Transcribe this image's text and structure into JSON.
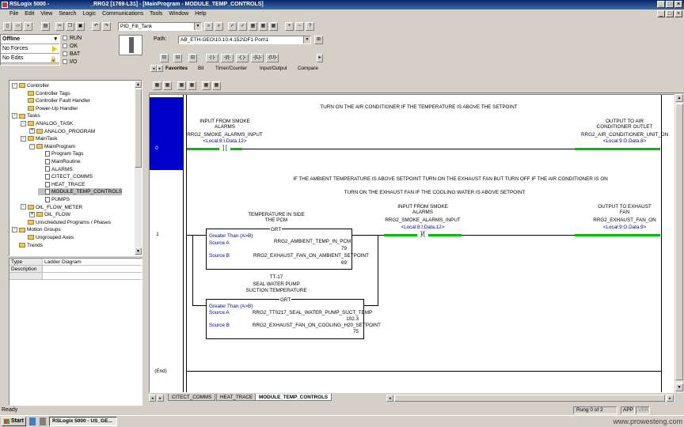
{
  "window": {
    "app_title": "RSLogix 5000 -",
    "doc_title": "_RRG2 [1769-L31] - [MainProgram - MODULE_TEMP_CONTROLS]"
  },
  "menu": [
    "File",
    "Edit",
    "View",
    "Search",
    "Logic",
    "Communications",
    "Tools",
    "Window",
    "Help"
  ],
  "toolbar": {
    "routine_combo": "PID_Fill_Tank",
    "path_label": "Path:",
    "path_value": "AB_ETH-GEO\\10.10.4.152\\DF1 Port\\1"
  },
  "controller_state": {
    "mode": "Offline",
    "forces": "No Forces",
    "edits": "No Edits",
    "indicators": [
      "RUN",
      "OK",
      "BAT",
      "I/O"
    ]
  },
  "instruction_tabs": [
    "Favorites",
    "Bit",
    "Timer/Counter",
    "Input/Output",
    "Compare"
  ],
  "tree": [
    {
      "label": "Controller",
      "indent": 0,
      "icon": "folder",
      "exp": "-"
    },
    {
      "label": "Controller Tags",
      "indent": 1,
      "icon": "folder"
    },
    {
      "label": "Controller Fault Handler",
      "indent": 1,
      "icon": "folder"
    },
    {
      "label": "Power-Up Handler",
      "indent": 1,
      "icon": "folder"
    },
    {
      "label": "Tasks",
      "indent": 0,
      "icon": "folder",
      "exp": "-"
    },
    {
      "label": "ANALOG_TASK",
      "indent": 1,
      "icon": "folder",
      "exp": "-"
    },
    {
      "label": "ANALOG_PROGRAM",
      "indent": 2,
      "icon": "folder",
      "exp": "+"
    },
    {
      "label": "MainTask",
      "indent": 1,
      "icon": "folder",
      "exp": "-"
    },
    {
      "label": "MainProgram",
      "indent": 2,
      "icon": "folder",
      "exp": "-"
    },
    {
      "label": "Program Tags",
      "indent": 3,
      "icon": "doc"
    },
    {
      "label": "MainRoutine",
      "indent": 3,
      "icon": "doc"
    },
    {
      "label": "ALARMS",
      "indent": 3,
      "icon": "doc"
    },
    {
      "label": "CITECT_COMMS",
      "indent": 3,
      "icon": "doc"
    },
    {
      "label": "HEAT_TRACE",
      "indent": 3,
      "icon": "doc"
    },
    {
      "label": "MODULE_TEMP_CONTROLS",
      "indent": 3,
      "icon": "doc",
      "selected": true
    },
    {
      "label": "PUMPS",
      "indent": 3,
      "icon": "doc"
    },
    {
      "label": "OIL_FLOW_METER",
      "indent": 1,
      "icon": "folder",
      "exp": "-"
    },
    {
      "label": "OIL_FLOW",
      "indent": 2,
      "icon": "folder",
      "exp": "+"
    },
    {
      "label": "Unscheduled Programs / Phases",
      "indent": 1,
      "icon": "folder"
    },
    {
      "label": "Motion Groups",
      "indent": 0,
      "icon": "folder",
      "exp": "-"
    },
    {
      "label": "Ungrouped Axes",
      "indent": 1,
      "icon": "folder"
    },
    {
      "label": "Trends",
      "indent": 0,
      "icon": "folder"
    }
  ],
  "props": {
    "type_key": "Type",
    "type_val": "Ladder Diagram",
    "desc_key": "Description",
    "desc_val": ""
  },
  "ladder": {
    "rung0": {
      "number": "0",
      "comment": "TURN ON THE AIR CONDITIONER IF THE TEMPERATURE IS ABOVE THE SETPOINT",
      "xic_desc1": "INPUT FROM SMOKE",
      "xic_desc2": "ALARMS",
      "xic_tag": "RRG2_SMOKE_ALARMS_INPUT",
      "xic_addr": "<Local:8:I.Data.12>",
      "ote_desc1": "OUTPUT TO AIR",
      "ote_desc2": "CONDITIONER OUTLET",
      "ote_tag": "RRG2_AIR_CONDITIONER_UNIT_ON",
      "ote_addr": "<Local:9:O.Data.8>"
    },
    "rung1": {
      "number": "1",
      "comment1": "IF THE AMBIENT TEMPERATURE IS ABOVE SETPOINT TURN ON THE EXHAUST FAN BUT TURN OFF IF THE AIR CONDITIONER IS ON",
      "comment2": "TURN ON THE EXHAUST FAN IF THE COOLING WATER IS ABOVE SETPOINT",
      "grt1_desc1": "TEMPERATURE IN SIDE",
      "grt1_desc2": "THE PCM",
      "grt1_mn": "GRT",
      "grt1_title": "Greater Than (A>B)",
      "grt1_srcA_label": "Source A",
      "grt1_srcA_tag": "RRG2_AMBIENT_TEMP_IN_PCM",
      "grt1_srcA_val": "79",
      "grt1_srcB_label": "Source B",
      "grt1_srcB_tag": "RRG2_EXHAUST_FAN_ON_AMBIENT_SETPOINT",
      "grt1_srcB_val": "69",
      "grt2_desc0": "TT-17",
      "grt2_desc1": "SEAL WATER PUMP",
      "grt2_desc2": "SUCTION TEMPERATURE",
      "grt2_mn": "GRT",
      "grt2_title": "Greater Than (A>B)",
      "grt2_srcA_label": "Source A",
      "grt2_srcA_tag": "RRG2_TT0217_SEAL_WATER_PUMP_SUCT_TEMP",
      "grt2_srcA_val": "102.3",
      "grt2_srcB_label": "Source B",
      "grt2_srcB_tag": "RRG2_EXHAUST_FAN_ON_COOLING_H20_SETPOINT",
      "grt2_srcB_val": "75",
      "xio_desc1": "INPUT FROM SMOKE",
      "xio_desc2": "ALARMS",
      "xio_tag": "RRG2_SMOKE_ALARMS_INPUT",
      "xio_addr": "<Local:8:I.Data.12>",
      "ote_desc1": "OUTPUT TO EXHAUST",
      "ote_desc2": "FAN",
      "ote_tag": "RRG2_EXHAUST_FAN_ON",
      "ote_addr": "<Local:9:O.Data.9>"
    },
    "end_label": "(End)"
  },
  "routine_tabs": [
    "CITECT_COMMS",
    "HEAT_TRACE",
    "MODULE_TEMP_CONTROLS"
  ],
  "status": {
    "left": "Ready",
    "rung": "Rung 0 of 2",
    "app": "APP",
    "ver": "VER"
  },
  "taskbar": {
    "start": "Start",
    "task": "RSLogix 5000 - US_GE...",
    "watermark": "www.prowesteng.com"
  }
}
